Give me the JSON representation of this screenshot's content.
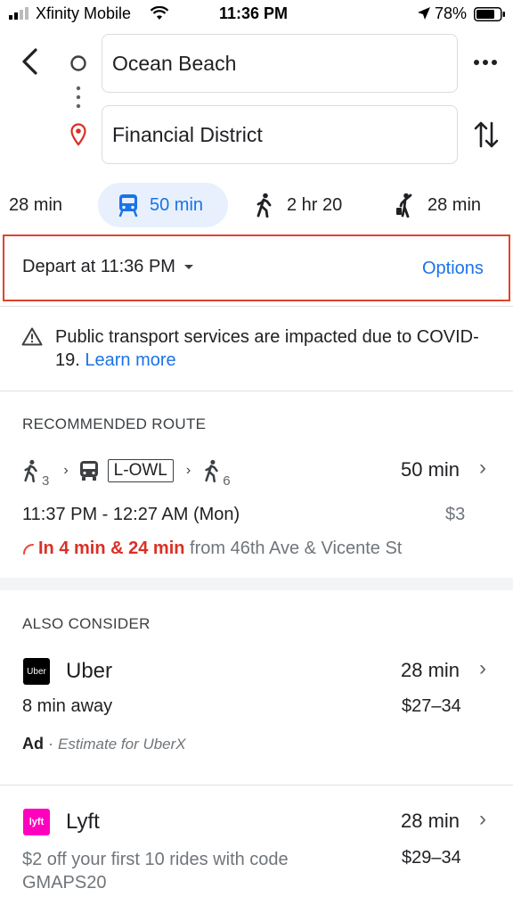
{
  "status_bar": {
    "carrier": "Xfinity Mobile",
    "time": "11:36 PM",
    "battery": "78%"
  },
  "search": {
    "origin": "Ocean Beach",
    "destination": "Financial District"
  },
  "modes": [
    {
      "label": "28 min",
      "icon": "car-icon",
      "active": false
    },
    {
      "label": "50 min",
      "icon": "transit-icon",
      "active": true
    },
    {
      "label": "2 hr 20",
      "icon": "walk-icon",
      "active": false
    },
    {
      "label": "28 min",
      "icon": "ride-hail-icon",
      "active": false
    }
  ],
  "depart": {
    "label": "Depart at 11:36 PM",
    "options_label": "Options"
  },
  "notice": {
    "text": "Public transport services are impacted due to COVID-19.",
    "link": "Learn more"
  },
  "recommended": {
    "section_title": "RECOMMENDED ROUTE",
    "walk_start_minutes": "3",
    "bus_line": "L-OWL",
    "walk_end_minutes": "6",
    "duration": "50 min",
    "times": "11:37 PM - 12:27 AM (Mon)",
    "fare": "$3",
    "realtime": "In 4 min & 24 min",
    "from_stop": "from 46th Ave & Vicente St"
  },
  "also_consider": {
    "section_title": "ALSO CONSIDER",
    "uber": {
      "logo_text": "Uber",
      "name": "Uber",
      "duration": "28 min",
      "eta": "8 min away",
      "price": "$27–34",
      "ad_label": "Ad",
      "ad_separator": "·",
      "ad_note": "Estimate for UberX"
    },
    "lyft": {
      "logo_text": "lyft",
      "name": "Lyft",
      "duration": "28 min",
      "promo": "$2 off your first 10 rides with code GMAPS20",
      "price": "$29–34"
    }
  },
  "colors": {
    "accent_blue": "#1a73e8",
    "active_tab_bg": "#e8f0fe",
    "highlight_red": "#e0432b",
    "realtime_red": "#d93025",
    "lyft_pink": "#ff00bf"
  }
}
